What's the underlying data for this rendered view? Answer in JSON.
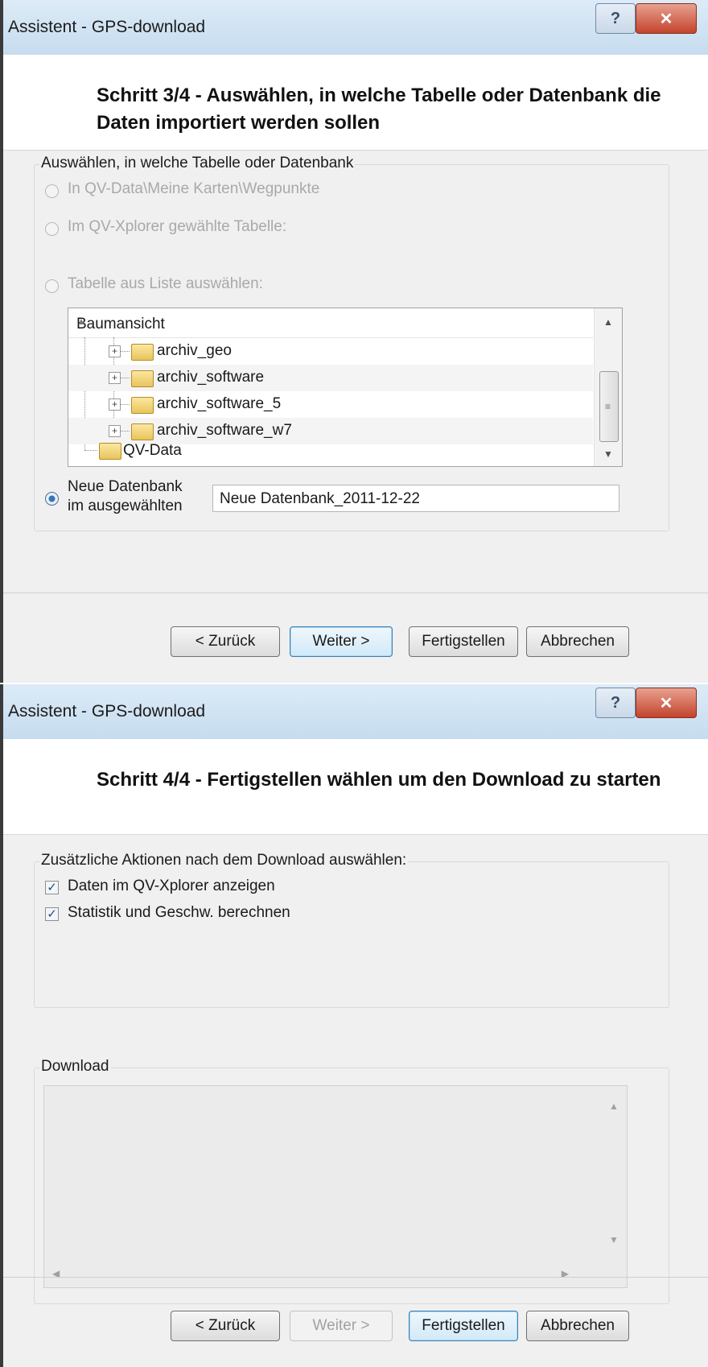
{
  "dialog1": {
    "title": "Assistent - GPS-download",
    "help_glyph": "?",
    "close_glyph": "✕",
    "header": "Schritt 3/4 - Auswählen, in welche Tabelle oder Datenbank die Daten importiert werden sollen",
    "group_label": "Auswählen, in welche Tabelle oder Datenbank",
    "options": [
      {
        "label": "In QV-Data\\Meine Karten\\Wegpunkte",
        "enabled": false,
        "checked": false
      },
      {
        "label": "Im QV-Xplorer gewählte Tabelle:",
        "enabled": false,
        "checked": false
      },
      {
        "label": "Tabelle aus Liste auswählen:",
        "enabled": false,
        "checked": false
      }
    ],
    "tree": {
      "header": "Baumansicht",
      "items": [
        "archiv_geo",
        "archiv_software",
        "archiv_software_5",
        "archiv_software_w7"
      ],
      "root": "QV-Data"
    },
    "new_db": {
      "label_line1": "Neue Datenbank",
      "label_line2": "im ausgewählten",
      "value": "Neue Datenbank_2011-12-22",
      "checked": true
    },
    "buttons": {
      "back": "< Zurück",
      "next": "Weiter >",
      "finish": "Fertigstellen",
      "cancel": "Abbrechen"
    }
  },
  "dialog2": {
    "title": "Assistent - GPS-download",
    "help_glyph": "?",
    "close_glyph": "✕",
    "header": "Schritt 4/4 - Fertigstellen wählen um den Download zu starten",
    "group_label": "Zusätzliche Aktionen nach dem Download auswählen:",
    "checkboxes": [
      {
        "label": "Daten im QV-Xplorer anzeigen",
        "checked": true
      },
      {
        "label": "Statistik und Geschw. berechnen",
        "checked": true
      }
    ],
    "download_label": "Download",
    "download_log": "",
    "buttons": {
      "back": "< Zurück",
      "next": "Weiter >",
      "finish": "Fertigstellen",
      "cancel": "Abbrechen"
    }
  },
  "colors": {
    "titlebar": "#c6dcef",
    "accent": "#3a73b6",
    "close": "#c4432c"
  }
}
